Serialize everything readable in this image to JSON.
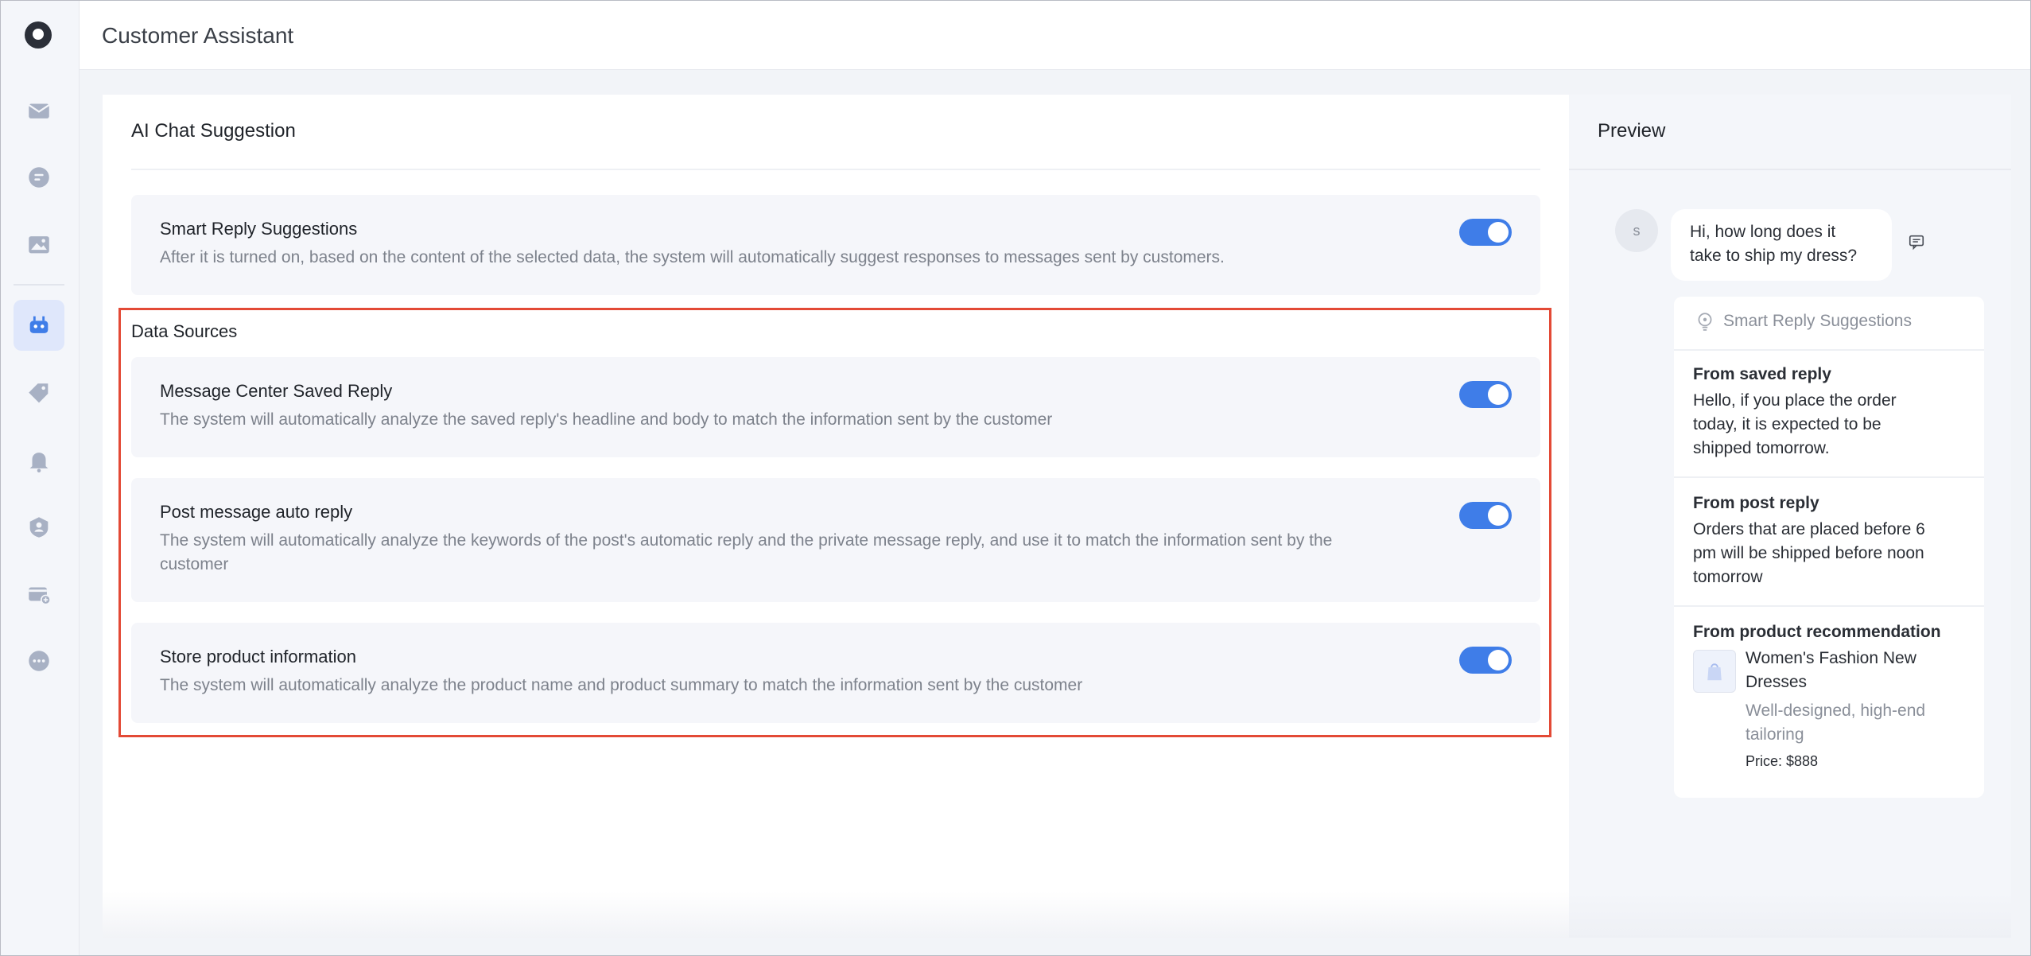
{
  "app": {
    "title": "Customer Assistant"
  },
  "sidebar": {
    "items": [
      {
        "icon": "mail-icon",
        "active": false
      },
      {
        "icon": "chat-icon",
        "active": false
      },
      {
        "icon": "image-icon",
        "active": false
      },
      {
        "icon": "robot-icon",
        "active": true
      },
      {
        "icon": "tag-icon",
        "active": false
      },
      {
        "icon": "bell-icon",
        "active": false
      },
      {
        "icon": "user-badge-icon",
        "active": false
      },
      {
        "icon": "card-add-icon",
        "active": false
      },
      {
        "icon": "more-icon",
        "active": false
      }
    ]
  },
  "main": {
    "title": "AI Chat Suggestion",
    "smart_reply": {
      "title": "Smart Reply Suggestions",
      "desc": "After it is turned on, based on the content of the selected data, the system will automatically suggest responses to messages sent by customers.",
      "enabled": true
    },
    "data_sources": {
      "label": "Data Sources",
      "items": [
        {
          "title": "Message Center Saved Reply",
          "desc": "The system will automatically analyze the saved reply's headline and body to match the information sent by the customer",
          "enabled": true
        },
        {
          "title": "Post message auto reply",
          "desc": "The system will automatically analyze the keywords of the post's automatic reply and the private message reply, and use it to match the information sent by the customer",
          "enabled": true
        },
        {
          "title": "Store product information",
          "desc": "The system will automatically analyze the product name and product summary to match the information sent by the customer",
          "enabled": true
        }
      ]
    }
  },
  "preview": {
    "title": "Preview",
    "avatar_letter": "s",
    "customer_message": "Hi, how long does it take to ship my dress?",
    "suggestions_header": "Smart Reply Suggestions",
    "saved": {
      "title": "From saved reply",
      "text": "Hello, if you place the order today, it is expected to be shipped tomorrow."
    },
    "post": {
      "title": "From post reply",
      "text": "Orders that are placed before 6 pm will be shipped before noon tomorrow"
    },
    "product": {
      "title": "From product recommendation",
      "name": "Women's Fashion New Dresses",
      "desc": "Well-designed, high-end tailoring",
      "price": "Price: $888"
    }
  },
  "colors": {
    "accent": "#3f7de8",
    "highlight_box": "#e34a36"
  }
}
